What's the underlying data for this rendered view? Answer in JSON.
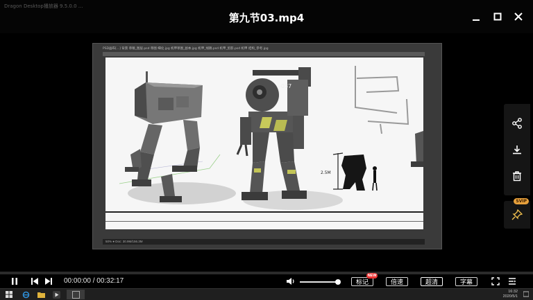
{
  "window": {
    "app_name": "Dragon Desktop播放器 9.5.0.0 ...",
    "title": "第九节03.mp4"
  },
  "video_frame": {
    "inner_tabs": "PSD画布[...]  背景 草稿_图层.psd  草图 细化.jpg  机甲草图_副本.jpg  机甲_线稿.psd  机甲_剪影.psd  机甲 结构_参考.jpg",
    "status_strip": "50%  ●  Doc: 30.9M/156.3M",
    "robot_code": "-037",
    "scale_label": "2.5M"
  },
  "playback": {
    "current_time": "00:00:00",
    "separator": " / ",
    "duration": "00:32:17",
    "progress": 0.0,
    "volume": 0.95
  },
  "buttons": {
    "mark": "标记",
    "mark_badge": "NEW",
    "speed": "倍速",
    "quality": "超清",
    "subtitle": "字幕"
  },
  "side_panel": {
    "items": [
      "share-icon",
      "download-icon",
      "delete-icon"
    ],
    "pin_badge": "SVIP"
  },
  "taskbar": {
    "clock_time": "16:32",
    "clock_date": "2020/5/1"
  },
  "colors": {
    "background": "#000000",
    "accent_badge": "#e8a13c",
    "new_badge": "#e33333"
  }
}
